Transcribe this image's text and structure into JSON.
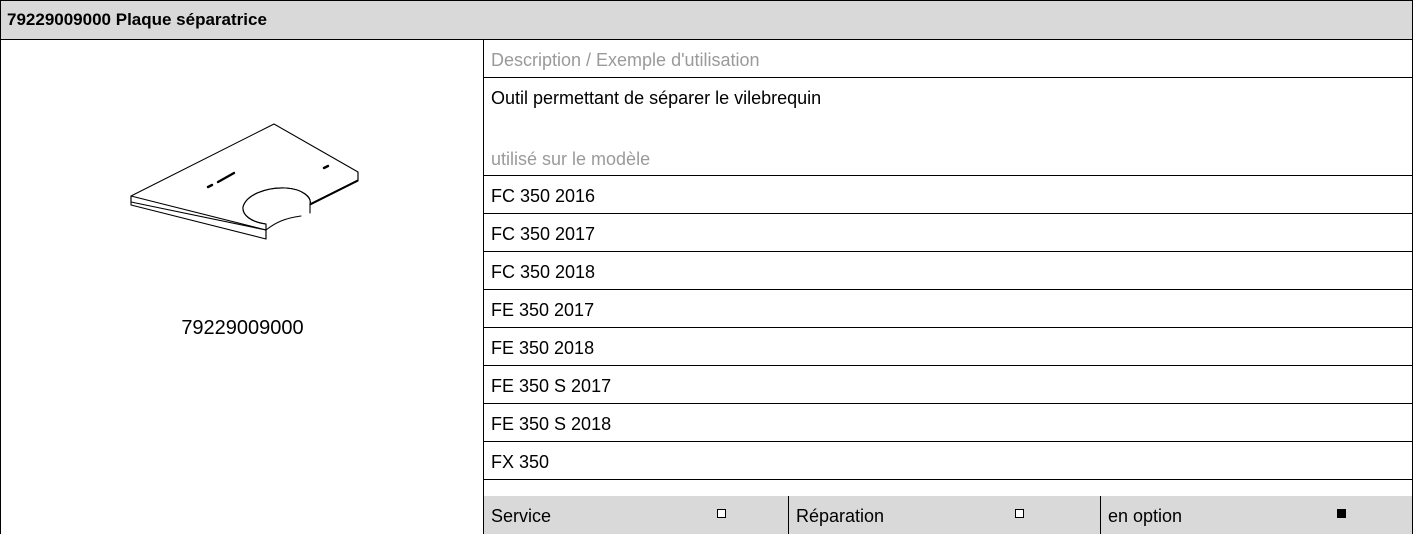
{
  "title": "79229009000 Plaque séparatrice",
  "tool": {
    "image_icon": "separator-plate-drawing",
    "part_number": "79229009000"
  },
  "description": {
    "heading": "Description / Exemple d'utilisation",
    "text": "Outil permettant de séparer le vilebrequin"
  },
  "models": {
    "heading": "utilisé sur le modèle",
    "items": [
      "FC 350 2016",
      "FC 350 2017",
      "FC 350 2018",
      "FE 350 2017",
      "FE 350 2018",
      "FE 350 S 2017",
      "FE 350 S 2018",
      "FX 350"
    ]
  },
  "categories": [
    {
      "label": "Service",
      "checked": false
    },
    {
      "label": "Réparation",
      "checked": false
    },
    {
      "label": "en option",
      "checked": true
    }
  ],
  "colors": {
    "header_bg": "#d9d9d9",
    "muted_text": "#9a9a9a",
    "border": "#000000"
  }
}
